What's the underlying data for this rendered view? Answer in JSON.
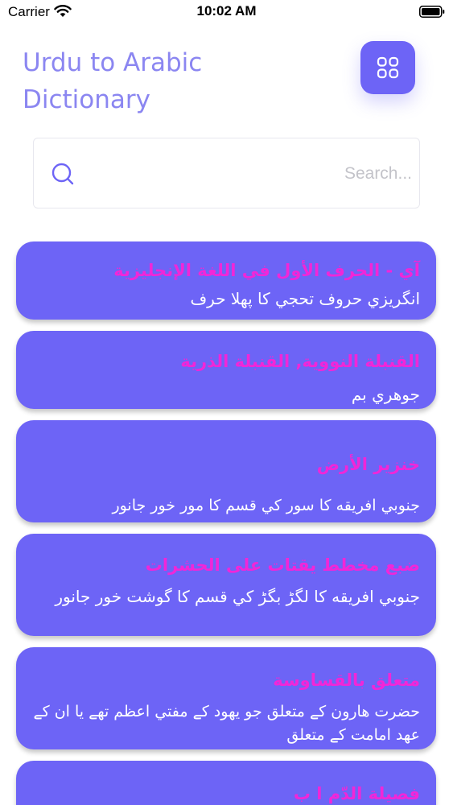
{
  "status_bar": {
    "carrier": "Carrier",
    "time": "10:02 AM"
  },
  "header": {
    "title": "Urdu to Arabic Dictionary",
    "menu_icon": "grid-icon"
  },
  "search": {
    "placeholder": "Search...",
    "value": "",
    "icon": "search-icon"
  },
  "entries": [
    {
      "arabic": "آي - الحرف الأول في اللغة الإنجليزية",
      "urdu": "انگريزي حروف تحجي کا پهلا حرف"
    },
    {
      "arabic": "القنبلة النووية, القنبلة الذرية",
      "urdu": "جوهري بم"
    },
    {
      "arabic": "خنزير الأرض",
      "urdu": "جنوبي افريقه کا سور کي قسم کا مور خور جانور"
    },
    {
      "arabic": "ضبع مخطط يقتات على الحشرات",
      "urdu": "جنوبي افريقه کا لگڑ بگڑ کي قسم کا گوشت خور جانور"
    },
    {
      "arabic": "متعلق بالقساوسة",
      "urdu": "حضرت هارون کے متعلق جو یهود کے مفتي اعظم تهے يا ان کے عهد امامت کے متعلق"
    },
    {
      "arabic": "فصيلة الدّم ا ب",
      "urdu": ""
    }
  ],
  "colors": {
    "accent": "#6d64f6",
    "title": "#8b86f1",
    "arabic_text": "#f126d8",
    "urdu_text": "#ffffff"
  }
}
